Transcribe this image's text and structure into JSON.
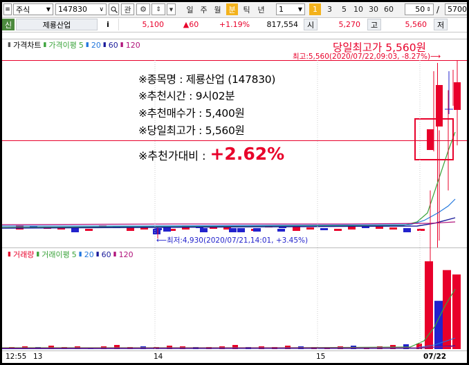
{
  "toolbar": {
    "market": "주식",
    "code": "147830",
    "search_icon": "search-icon",
    "watch_label": "관",
    "periods": [
      "일",
      "주",
      "월",
      "분",
      "틱",
      "년"
    ],
    "active_period": "분",
    "interval": "1",
    "minute_options": [
      "1",
      "3",
      "5",
      "10",
      "30",
      "60"
    ],
    "active_minute": "1",
    "count": "50",
    "max": "5700"
  },
  "info": {
    "prefix": "신",
    "name": "제룡산업",
    "info_button": "i",
    "price": "5,100",
    "change": "▲60",
    "change_pct": "+1.19%",
    "volume": "817,554",
    "open_label": "시",
    "open": "5,270",
    "high_label": "고",
    "high": "5,560",
    "low_label": "저"
  },
  "price_legend": {
    "title": "가격차트",
    "ma_label": "가격이평",
    "ma": [
      "5",
      "20",
      "60",
      "120"
    ]
  },
  "volume_legend": {
    "title": "거래량",
    "ma_label": "거래이평",
    "ma": [
      "5",
      "20",
      "60",
      "120"
    ]
  },
  "annotation": {
    "line1": "※종목명 : 제룡산업 (147830)",
    "line2": "※추천시간 : 9시02분",
    "line3": "※추천매수가 : 5,400원",
    "line4": "※당일최고가 : 5,560원",
    "line5_label": "※추천가대비 :",
    "line5_value": "+2.62%"
  },
  "chart_labels": {
    "headline": "당일최고가 5,560원",
    "high_marker": "최고:5,560(2020/07/22,09:03, -8.27%)⟶",
    "low_marker": "⟵최저:4,930(2020/07/21,14:01, +3.45%)"
  },
  "x_axis": {
    "time": "12:55",
    "ticks": [
      "13",
      "14",
      "15",
      "07/22"
    ]
  },
  "colors": {
    "up": "#e8002a",
    "down": "#2222cc",
    "ma5": "#3aa33a",
    "ma20": "#2277dd",
    "ma60": "#1a1a9a",
    "ma120": "#b0127a"
  },
  "chart_data": {
    "type": "candlestick",
    "high_price": 5560,
    "low_price": 4930,
    "buy_price": 5400,
    "price_candles": [
      {
        "t": "07/22 09:00",
        "o": 5100,
        "h": 5300,
        "l": 5050,
        "c": 5270
      },
      {
        "t": "07/22 09:01",
        "o": 5270,
        "h": 5420,
        "l": 5200,
        "c": 5380
      },
      {
        "t": "07/22 09:02",
        "o": 5380,
        "h": 5500,
        "l": 5300,
        "c": 5440
      },
      {
        "t": "07/22 09:03",
        "o": 5440,
        "h": 5560,
        "l": 5390,
        "c": 5470
      }
    ],
    "volume_bars_recent": [
      {
        "t": "07/22 09:00",
        "v": 100,
        "color": "up"
      },
      {
        "t": "07/22 09:01",
        "v": 55,
        "color": "down"
      },
      {
        "t": "07/22 09:02",
        "v": 90,
        "color": "up"
      },
      {
        "t": "07/22 09:03",
        "v": 85,
        "color": "up"
      }
    ]
  }
}
